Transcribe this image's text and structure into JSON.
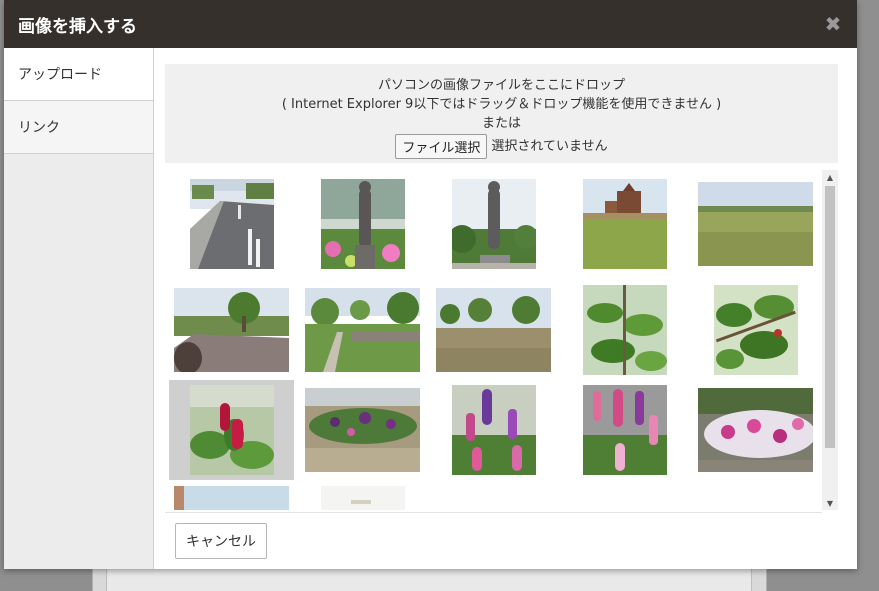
{
  "dialog": {
    "title": "画像を挿入する",
    "close_icon": "close-icon"
  },
  "sidebar": {
    "tabs": [
      {
        "label": "アップロード",
        "active": true
      },
      {
        "label": "リンク",
        "active": false
      }
    ]
  },
  "dropzone": {
    "line1": "パソコンの画像ファイルをここにドロップ",
    "line2": "( Internet Explorer 9以下ではドラッグ＆ドロップ機能を使用できません )",
    "line3": "または",
    "file_button_label": "ファイル選択",
    "file_status": "選択されていません"
  },
  "gallery": {
    "thumbnails": [
      {
        "subject": "road",
        "selected": false
      },
      {
        "subject": "statue-flowers",
        "selected": false
      },
      {
        "subject": "statue-garden",
        "selected": false
      },
      {
        "subject": "park-playground",
        "selected": false
      },
      {
        "subject": "lawn-field",
        "selected": false
      },
      {
        "subject": "park-path",
        "selected": false
      },
      {
        "subject": "park-walkway",
        "selected": false
      },
      {
        "subject": "park-trees",
        "selected": false
      },
      {
        "subject": "green-leaves",
        "selected": false
      },
      {
        "subject": "cherry-branch",
        "selected": false
      },
      {
        "subject": "red-flowers",
        "selected": true
      },
      {
        "subject": "flower-bed-purple",
        "selected": false
      },
      {
        "subject": "lupines-purple",
        "selected": false
      },
      {
        "subject": "lupines-pink",
        "selected": false
      },
      {
        "subject": "petunia-bed",
        "selected": false
      },
      {
        "subject": "partial-sky",
        "selected": false
      },
      {
        "subject": "partial-white",
        "selected": false
      }
    ]
  },
  "footer": {
    "cancel_label": "キャンセル"
  },
  "colors": {
    "titlebar": "#35302c",
    "sidebar": "#ececec",
    "dropzone": "#f0f0f0",
    "selected_thumb": "#cfcfcf"
  }
}
